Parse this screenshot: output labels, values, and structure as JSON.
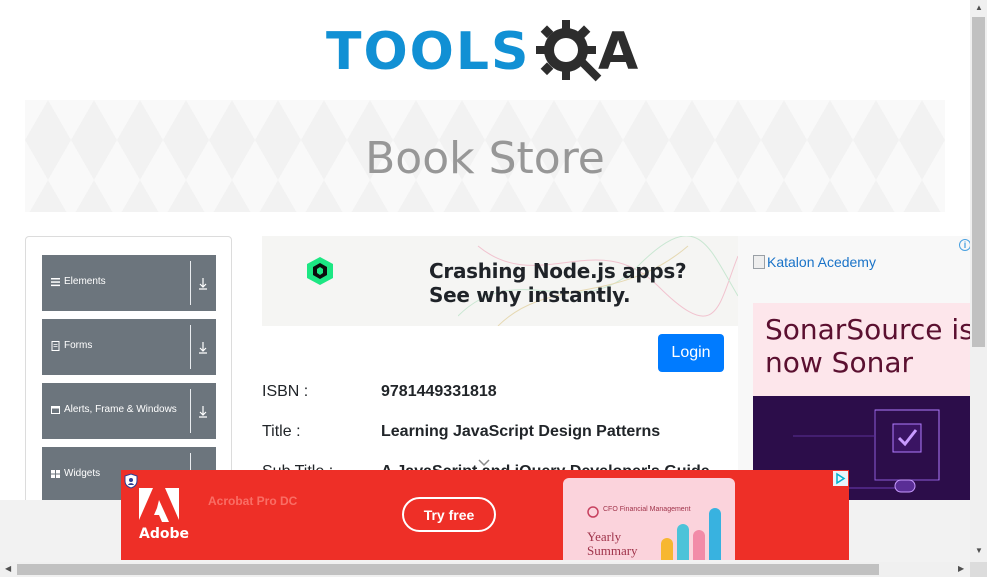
{
  "header": {
    "logo_word": "TOOLS",
    "logo_letter": "A"
  },
  "banner": {
    "title": "Book Store"
  },
  "sidebar": {
    "groups": [
      {
        "label": "Elements",
        "icon": "hamburger-icon"
      },
      {
        "label": "Forms",
        "icon": "document-icon"
      },
      {
        "label": "Alerts, Frame & Windows",
        "icon": "window-icon"
      },
      {
        "label": "Widgets",
        "icon": "grid-icon"
      }
    ]
  },
  "ad_top": {
    "line1": "Crashing Node.js apps?",
    "line2": "See why instantly."
  },
  "auth": {
    "login_label": "Login"
  },
  "book": {
    "isbn_label": "ISBN :",
    "isbn_value": "9781449331818",
    "title_label": "Title :",
    "title_value": "Learning JavaScript Design Patterns",
    "subtitle_label": "Sub Title :",
    "subtitle_value": "A JavaScript and jQuery Developer's Guide"
  },
  "ad_right": {
    "katalon_text": "Katalon Acedemy",
    "sonar_line1": "SonarSource is",
    "sonar_line2": "now Sonar"
  },
  "ad_bottom": {
    "brand": "Adobe",
    "product": "Acrobat Pro DC",
    "cta": "Try free",
    "card_brand": "CFO Financial Management",
    "card_title_1": "Yearly",
    "card_title_2": "Summary"
  },
  "colors": {
    "brand_blue": "#1190d4",
    "login_blue": "#007bff",
    "sidebar_gray": "#6c757d",
    "ad_red": "#ee2f27"
  }
}
